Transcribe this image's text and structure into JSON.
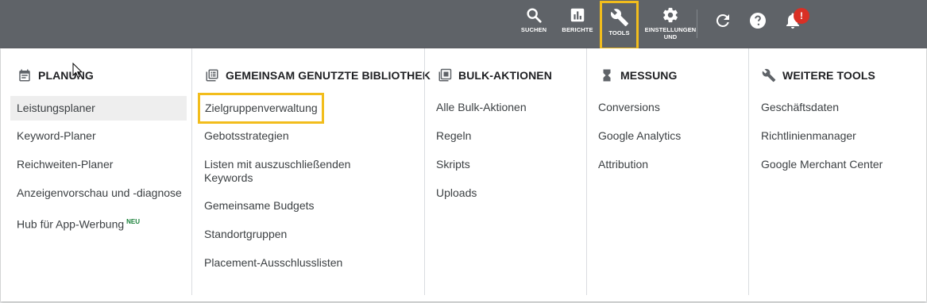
{
  "topbar": {
    "search_label": "SUCHEN",
    "reports_label": "BERICHTE",
    "tools_label": "TOOLS",
    "settings_label": "EINSTELLUNGEN UND ABRECHNUNG",
    "notification_badge": "!",
    "icons": [
      "search-icon",
      "reports-icon",
      "wrench-icon",
      "gear-icon",
      "refresh-icon",
      "help-icon",
      "bell-icon"
    ]
  },
  "columns": [
    {
      "title": "PLANUNG",
      "icon": "calendar-icon",
      "items": [
        "Leistungsplaner",
        "Keyword-Planer",
        "Reichweiten-Planer",
        "Anzeigenvorschau und -diagnose",
        "Hub für App-Werbung"
      ],
      "new_badge": "NEU"
    },
    {
      "title": "GEMEINSAM GENUTZTE BIBLIOTHEK",
      "icon": "library-icon",
      "items": [
        "Zielgruppenverwaltung",
        "Gebotsstrategien",
        "Listen mit auszuschließenden",
        "Keywords",
        "Gemeinsame Budgets",
        "Standortgruppen",
        "Placement-Ausschlusslisten"
      ]
    },
    {
      "title": "BULK-AKTIONEN",
      "icon": "bulk-actions-icon",
      "items": [
        "Alle Bulk-Aktionen",
        "Regeln",
        "Skripts",
        "Uploads"
      ]
    },
    {
      "title": "MESSUNG",
      "icon": "hourglass-icon",
      "items": [
        "Conversions",
        "Google Analytics",
        "Attribution"
      ]
    },
    {
      "title": "WEITERE TOOLS",
      "icon": "wrench-icon",
      "items": [
        "Geschäftsdaten",
        "Richtlinienmanager",
        "Google Merchant Center"
      ]
    }
  ],
  "colors": {
    "topbar": "#5f6368",
    "highlight": "#f2bd1c",
    "badge": "#d93025",
    "new": "#188038"
  }
}
